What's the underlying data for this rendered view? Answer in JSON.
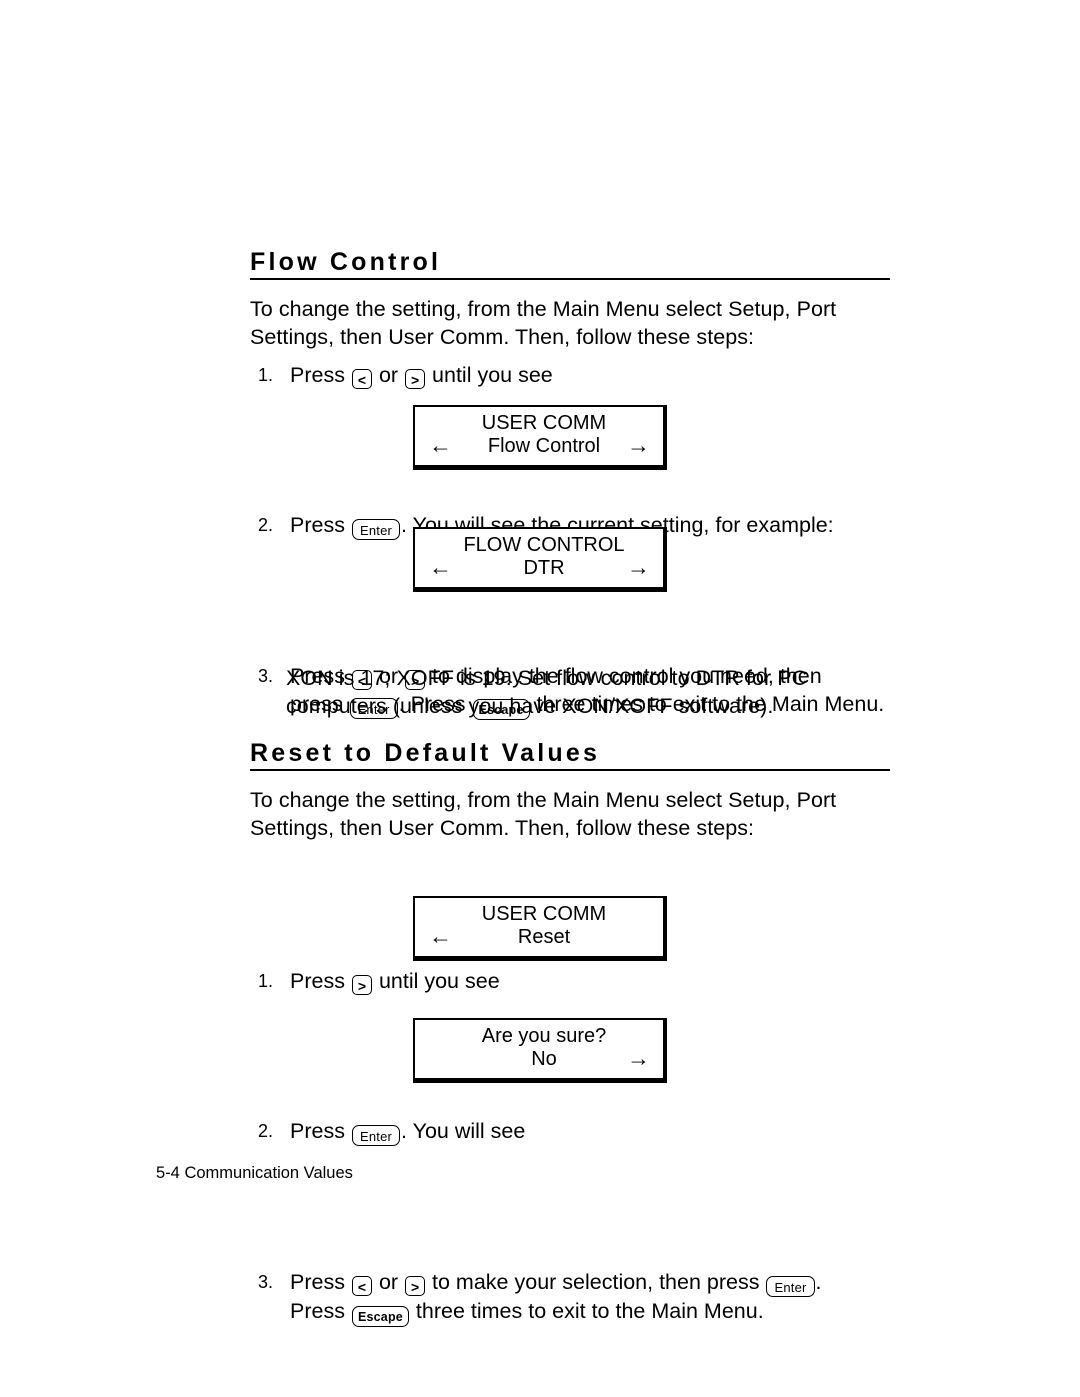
{
  "document": {
    "footer": {
      "page_number": "5-4",
      "chapter_title": "Communication Values"
    }
  },
  "keys": {
    "left": "<",
    "right": ">",
    "enter": "Enter",
    "escape": "Escape"
  },
  "arrows": {
    "left": "←",
    "right": "→"
  },
  "sections": [
    {
      "heading": "Flow Control",
      "intro_line1": "To change the setting, from the Main Menu select Setup, Port",
      "intro_line2": "Settings, then User Comm.  Then, follow these steps:",
      "steps": [
        {
          "number": "1.",
          "text_before": "Press",
          "text_mid": "or",
          "text_after": "until you see"
        },
        {
          "number": "2.",
          "text_before": "Press",
          "text_after": ".  You will see the current setting, for example:"
        },
        {
          "number": "3.",
          "line1_before": "Press",
          "line1_mid": "or",
          "line1_after": "to display the flow control you need, then",
          "line2_before": "press",
          "line2_mid": ".  Press",
          "line2_after": "three times to exit to the Main Menu."
        }
      ],
      "note_line1": "XON is 17; XOFF is 19.  Set flow control to DTR for PC",
      "note_line2": "computers (unless you have XON/XOFF software).",
      "displays": [
        {
          "line1": "USER COMM",
          "line2": "Flow Control",
          "show_left_arrow": true,
          "show_right_arrow": true
        },
        {
          "line1": "FLOW CONTROL",
          "line2": "DTR",
          "show_left_arrow": true,
          "show_right_arrow": true
        }
      ]
    },
    {
      "heading": "Reset to Default Values",
      "intro_line1": "To change the setting, from the Main Menu select Setup, Port",
      "intro_line2": "Settings, then User Comm.  Then, follow these steps:",
      "steps": [
        {
          "number": "1.",
          "text_before": "Press",
          "text_after": "until you see"
        },
        {
          "number": "2.",
          "text_before": "Press",
          "text_after": ".  You will see"
        },
        {
          "number": "3.",
          "line1_before": "Press",
          "line1_mid": "or",
          "line1_after": "to make your selection, then press",
          "line1_end": ".",
          "line2_before": "Press",
          "line2_after": "three times to exit to the Main Menu."
        }
      ],
      "displays": [
        {
          "line1": "USER COMM",
          "line2": "Reset",
          "show_left_arrow": true,
          "show_right_arrow": false
        },
        {
          "line1": "Are you sure?",
          "line2": "No",
          "show_left_arrow": false,
          "show_right_arrow": true
        }
      ]
    }
  ]
}
